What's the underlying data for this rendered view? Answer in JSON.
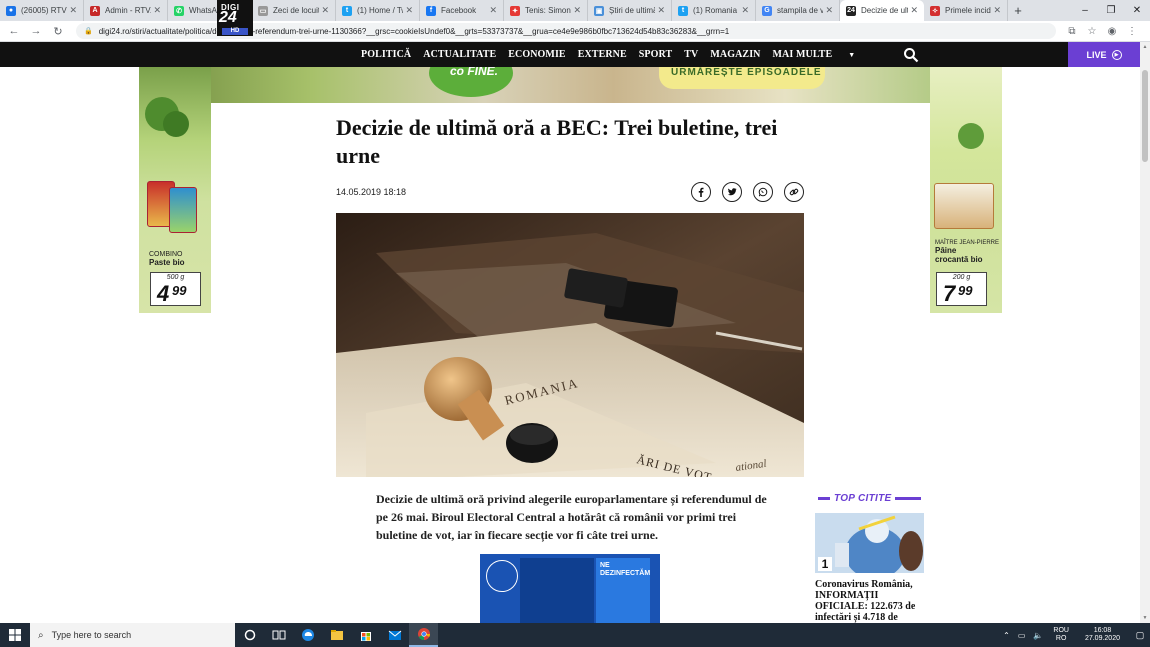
{
  "browser": {
    "tabs": [
      {
        "title": "(26005) RTV W",
        "fav_color": "#1a73e8",
        "fav_glyph": "●"
      },
      {
        "title": "Admin - RTV.r",
        "fav_color": "#c62828",
        "fav_glyph": "A"
      },
      {
        "title": "WhatsApp",
        "fav_color": "#25d366",
        "fav_glyph": "✆"
      },
      {
        "title": "Zeci de locuit",
        "fav_color": "#999999",
        "fav_glyph": "▭"
      },
      {
        "title": "(1) Home / Tw",
        "fav_color": "#1da1f2",
        "fav_glyph": "t"
      },
      {
        "title": "Facebook",
        "fav_color": "#1877f2",
        "fav_glyph": "f"
      },
      {
        "title": "Tenis: Simona",
        "fav_color": "#e53935",
        "fav_glyph": "✦"
      },
      {
        "title": "Știri de ultimă",
        "fav_color": "#4a90d9",
        "fav_glyph": "▣"
      },
      {
        "title": "(1) Romania -",
        "fav_color": "#1da1f2",
        "fav_glyph": "t"
      },
      {
        "title": "stampila de vo",
        "fav_color": "#4285f4",
        "fav_glyph": "G"
      },
      {
        "title": "Decizie de ulti",
        "fav_color": "#222222",
        "fav_glyph": "24",
        "active": true
      },
      {
        "title": "Primele incide",
        "fav_color": "#d32f2f",
        "fav_glyph": "✧"
      }
    ],
    "url": "digi24.ro/stiri/actualitate/politica/decizie-bec-referendum-trei-urne-1130366?__grsc=cookieIsUndef0&__grts=53373737&__grua=ce4e9e986b0fbc713624d54b83c36283&__grrn=1"
  },
  "site": {
    "logo_top": "DIGI",
    "logo_main": "24",
    "logo_sub": "HD",
    "menu": [
      "POLITICĂ",
      "ACTUALITATE",
      "ECONOMIE",
      "EXTERNE",
      "SPORT",
      "TV",
      "MAGAZIN"
    ],
    "menu_more": "MAI MULTE",
    "live_label": "LIVE"
  },
  "ads": {
    "top_blob_text": "co FINE.",
    "top_banner_text": "URMĂREȘTE EPISOADELE",
    "left": {
      "brand": "COMBINO",
      "product": "Paste bio",
      "weight": "500 g",
      "price_int": "4",
      "price_dec": "99"
    },
    "right": {
      "brand": "MAÎTRE JEAN-PIERRE",
      "product_line1": "Pâine",
      "product_line2": "crocantă bio",
      "weight": "200 g",
      "price_int": "7",
      "price_dec": "99"
    },
    "gov_text": "NE DEZINFECTĂM"
  },
  "article": {
    "headline": "Decizie de ultimă oră a BEC: Trei buletine, trei urne",
    "date": "14.05.2019 18:18",
    "hero_text_1": "ROMANIA",
    "hero_text_2": "ĂRI DE VOT",
    "hero_text_3": "ational",
    "lede": "Decizie de ultimă oră privind alegerile europarlamentare și referendumul de pe 26 mai. Biroul Electoral Central a hotărât că românii vor primi trei buletine de vot, iar în fiecare secție vor fi câte trei urne."
  },
  "top_citite": {
    "label": "TOP CITITE",
    "items": [
      {
        "rank": "1",
        "title": "Coronavirus România, INFORMAȚII OFICIALE: 122.673 de infectări și 4.718 de"
      }
    ]
  },
  "taskbar": {
    "search_placeholder": "Type here to search",
    "lang_1": "ROU",
    "lang_2": "RO",
    "time": "16:08",
    "date": "27.09.2020"
  },
  "colors": {
    "accent": "#6b3fd3",
    "nav_bg": "#111111",
    "taskbar_bg": "#1f2b38"
  }
}
